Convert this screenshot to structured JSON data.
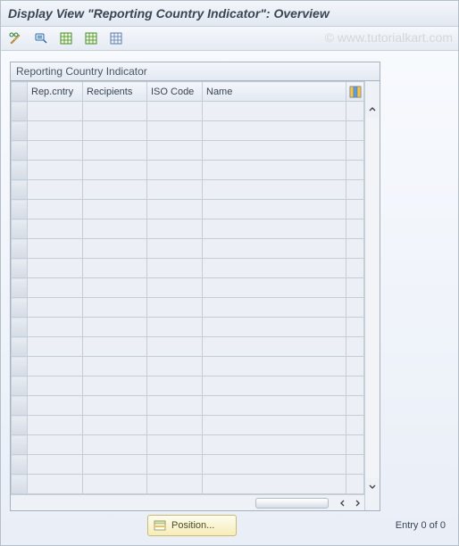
{
  "title": "Display View \"Reporting Country Indicator\": Overview",
  "watermark": "© www.tutorialkart.com",
  "toolbar": {
    "change_display": "change-display",
    "find": "find",
    "export1": "export",
    "export2": "export",
    "export3": "export"
  },
  "table": {
    "group_title": "Reporting Country Indicator",
    "columns": {
      "rep_cntry": "Rep.cntry",
      "recipients": "Recipients",
      "iso_code": "ISO Code",
      "name": "Name"
    },
    "row_count": 20
  },
  "footer": {
    "position_label": "Position...",
    "status": "Entry 0 of 0"
  }
}
